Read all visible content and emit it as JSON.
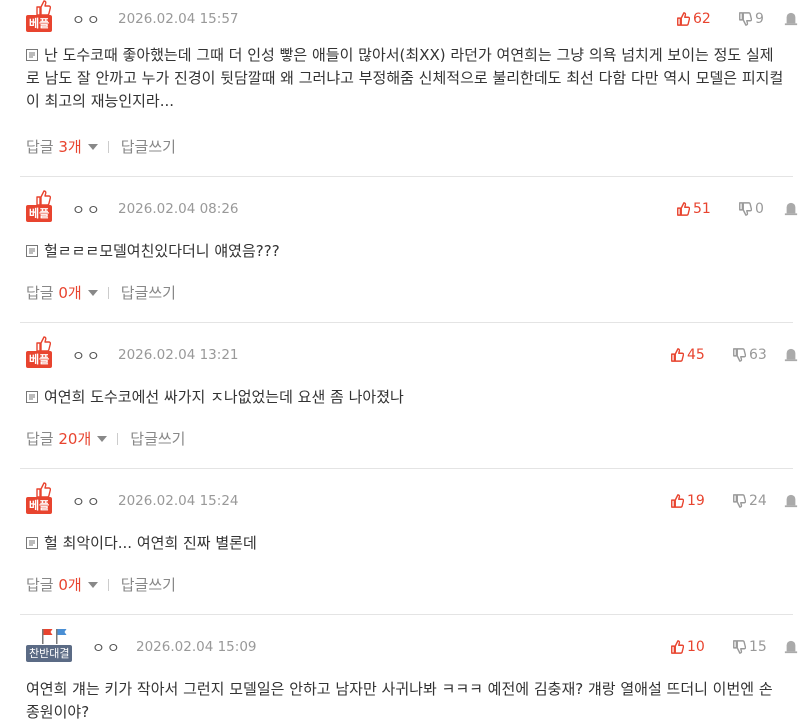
{
  "comments": [
    {
      "badge": "베플",
      "nick": "ㅇㅇ",
      "date": "2026.02.04 15:57",
      "up": "62",
      "down": "9",
      "text": "난 도수코때 좋아했는데 그때 더 인성 빻은 애들이 많아서(최XX) 라던가 여연희는 그냥 의욕 넘치게 보이는 정도 실제로 남도 잘 안까고 누가 진경이 뒷담깔때 왜 그러냐고 부정해줌 신체적으로 불리한데도 최선 다함 다만 역시 모델은 피지컬이 최고의 재능인지라...",
      "reply_label": "답글",
      "reply_count": "3개",
      "write_label": "답글쓰기"
    },
    {
      "badge": "베플",
      "nick": "ㅇㅇ",
      "date": "2026.02.04 08:26",
      "up": "51",
      "down": "0",
      "text": "헐ㄹㄹㄹ모델여친있다더니 얘였음???",
      "reply_label": "답글",
      "reply_count": "0개",
      "write_label": "답글쓰기"
    },
    {
      "badge": "베플",
      "nick": "ㅇㅇ",
      "date": "2026.02.04 13:21",
      "up": "45",
      "down": "63",
      "text": "여연희 도수코에선 싸가지 ㅈ나없었는데 요샌 좀 나아졌나",
      "reply_label": "답글",
      "reply_count": "20개",
      "write_label": "답글쓰기"
    },
    {
      "badge": "베플",
      "nick": "ㅇㅇ",
      "date": "2026.02.04 15:24",
      "up": "19",
      "down": "24",
      "text": "헐 최악이다... 여연희 진짜 별론데",
      "reply_label": "답글",
      "reply_count": "0개",
      "write_label": "답글쓰기"
    },
    {
      "badge": "찬반대결",
      "nick": "ㅇㅇ",
      "date": "2026.02.04 15:09",
      "up": "10",
      "down": "15",
      "text": "여연희 걔는 키가 작아서 그런지 모델일은 안하고 남자만 사귀나봐 ㅋㅋㅋ 예전에 김충재? 걔랑 열애설 뜨더니 이번엔 손종원이야?"
    }
  ],
  "icons": {
    "thumb_up": "thumb-up-icon",
    "thumb_down": "thumb-down-icon",
    "memo": "memo-icon",
    "report": "report-icon",
    "flag": "flag-icon"
  },
  "colors": {
    "accent": "#e8442f",
    "camp": "#5b6b85",
    "muted": "#999999"
  }
}
